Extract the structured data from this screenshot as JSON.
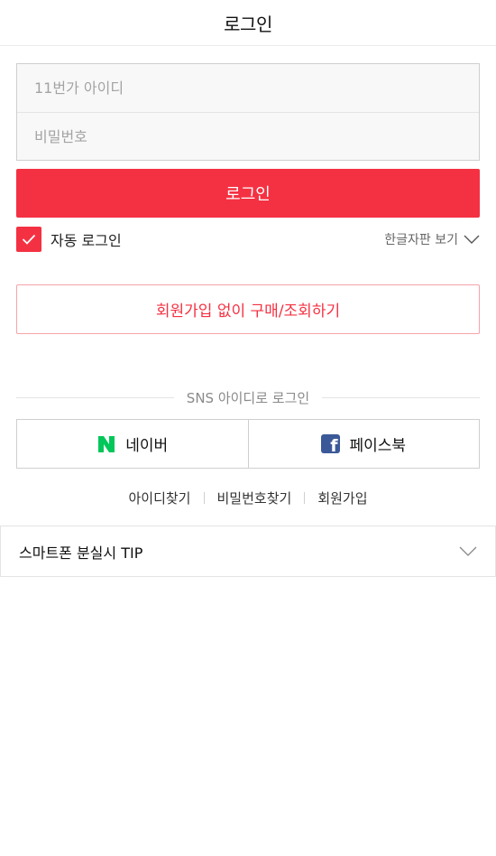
{
  "header": {
    "title": "로그인"
  },
  "login_form": {
    "id_placeholder": "11번가 아이디",
    "password_placeholder": "비밀번호",
    "login_button": "로그인"
  },
  "options": {
    "auto_login": {
      "label": "자동 로그인",
      "checked": true
    },
    "keyboard_link": "한글자판 보기"
  },
  "join_without_signup": "회원가입 없이 구매/조회하기",
  "sns": {
    "divider": "SNS 아이디로 로그인",
    "naver": "네이버",
    "facebook": "페이스북"
  },
  "find_links": {
    "find_id": "아이디찾기",
    "find_password": "비밀번호찾기",
    "join": "회원가입"
  },
  "tip": {
    "label": "스마트폰 분실시 TIP"
  },
  "colors": {
    "accent": "#f43142",
    "naver": "#03c75a",
    "facebook": "#3b5998"
  },
  "icons": [
    "check-icon",
    "chevron-down-icon",
    "naver-logo-icon",
    "facebook-logo-icon"
  ]
}
